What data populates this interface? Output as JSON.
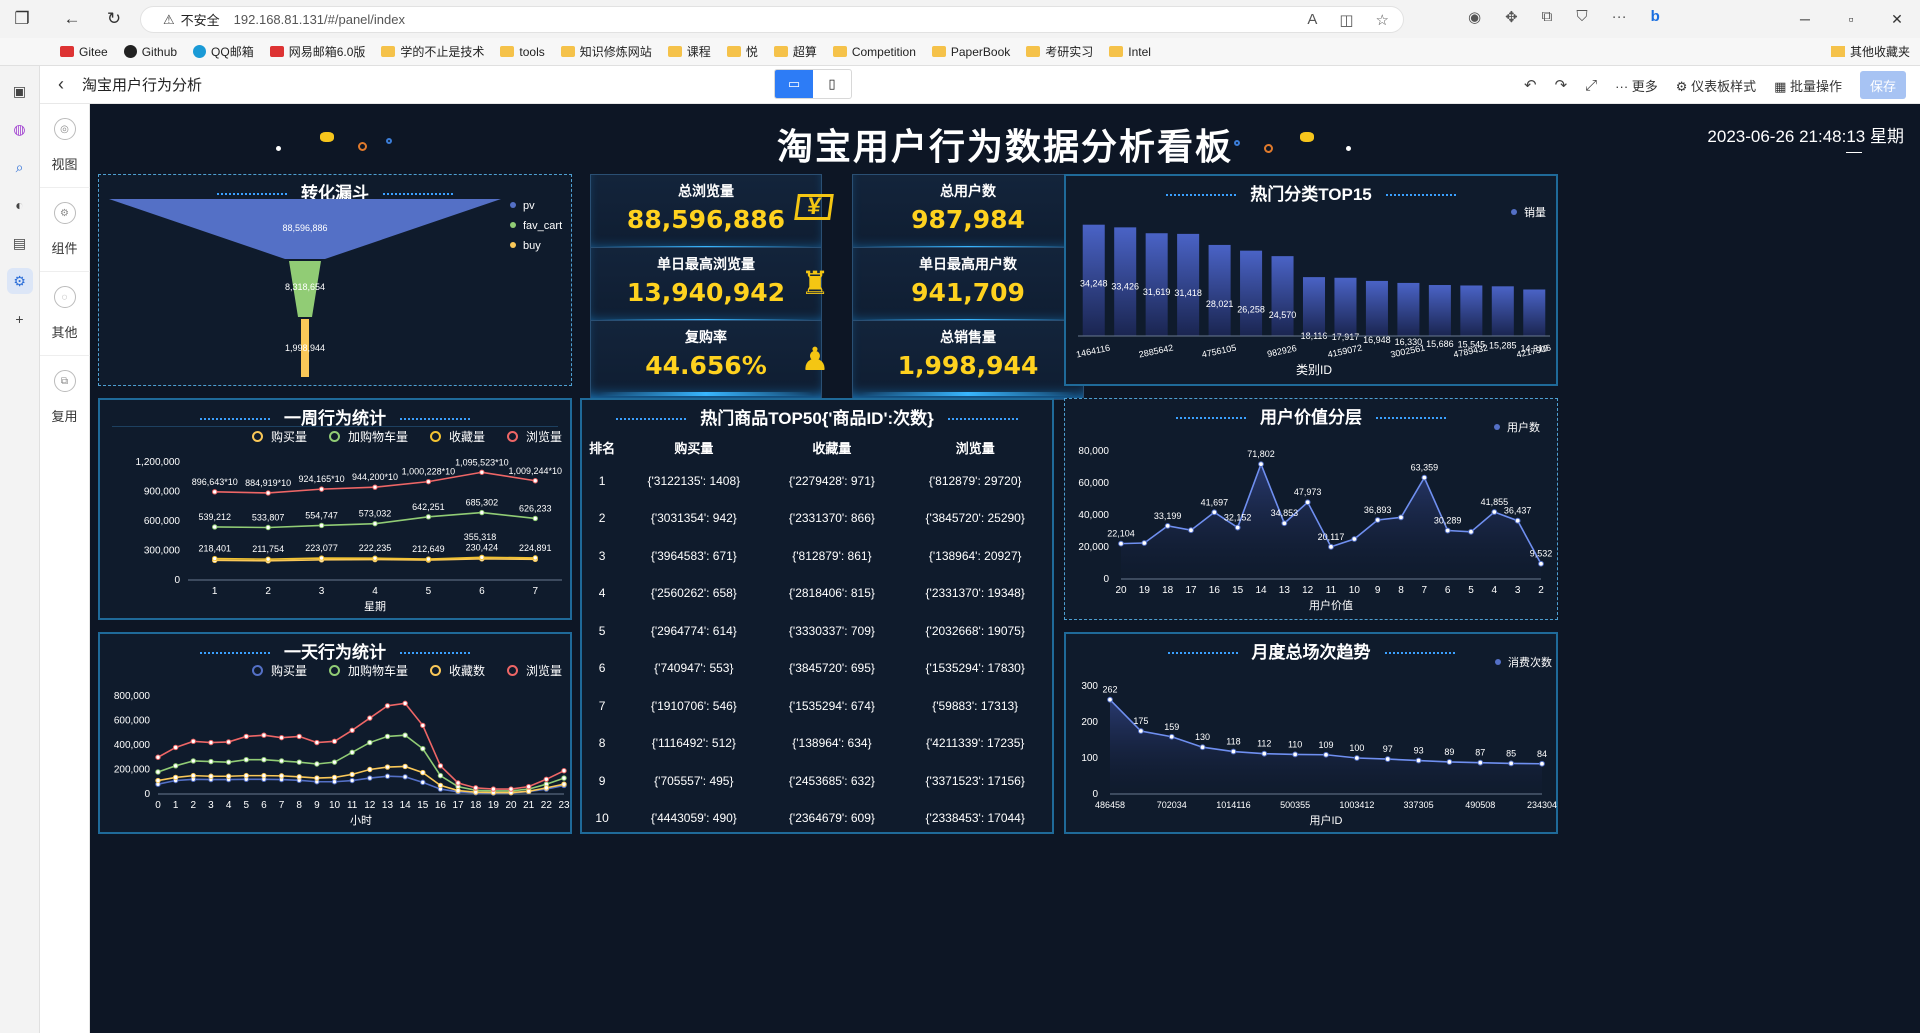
{
  "browser": {
    "security": "不安全",
    "url": "192.168.81.131/#/panel/index"
  },
  "bookmarks": [
    {
      "label": "Gitee",
      "kind": "red"
    },
    {
      "label": "Github",
      "kind": "dark"
    },
    {
      "label": "QQ邮箱",
      "kind": "qq"
    },
    {
      "label": "网易邮箱6.0版",
      "kind": "red"
    },
    {
      "label": "学的不止是技术",
      "kind": "folder"
    },
    {
      "label": "tools",
      "kind": "folder"
    },
    {
      "label": "知识修炼网站",
      "kind": "folder"
    },
    {
      "label": "课程",
      "kind": "folder"
    },
    {
      "label": "悦",
      "kind": "folder"
    },
    {
      "label": "超算",
      "kind": "folder"
    },
    {
      "label": "Competition",
      "kind": "folder"
    },
    {
      "label": "PaperBook",
      "kind": "folder"
    },
    {
      "label": "考研实习",
      "kind": "folder"
    },
    {
      "label": "Intel",
      "kind": "folder"
    }
  ],
  "bookmarks_other": "其他收藏夹",
  "app": {
    "title": "淘宝用户行为分析",
    "more": "更多",
    "style": "仪表板样式",
    "batch": "批量操作",
    "save": "保存"
  },
  "leftpanel": [
    {
      "label": "视图"
    },
    {
      "label": "组件"
    },
    {
      "label": "其他"
    },
    {
      "label": "复用"
    }
  ],
  "dashboard": {
    "title": "淘宝用户行为数据分析看板",
    "time": "2023-06-26 21:48:13 星期"
  },
  "kpis": [
    {
      "label": "总浏览量",
      "value": "88,596,886"
    },
    {
      "label": "总用户数",
      "value": "987,984"
    },
    {
      "label": "单日最高浏览量",
      "value": "13,940,942"
    },
    {
      "label": "单日最高用户数",
      "value": "941,709"
    },
    {
      "label": "复购率",
      "value": "44.656%"
    },
    {
      "label": "总销售量",
      "value": "1,998,944"
    }
  ],
  "funnel": {
    "title": "转化漏斗",
    "legend": [
      "pv",
      "fav_cart",
      "buy"
    ],
    "labels": [
      "88,596,886",
      "8,318,654",
      "1,998,944"
    ]
  },
  "chart_data": [
    {
      "id": "funnel",
      "type": "funnel",
      "title": "转化漏斗",
      "categories": [
        "pv",
        "fav_cart",
        "buy"
      ],
      "values": [
        88596886,
        8318654,
        1998944
      ],
      "colors": [
        "#5470c6",
        "#91cc75",
        "#fac858"
      ]
    },
    {
      "id": "top15",
      "type": "bar",
      "title": "热门分类TOP15",
      "xlabel": "类别ID",
      "series": [
        {
          "name": "销量",
          "values": [
            34248,
            33426,
            31619,
            31418,
            28021,
            26258,
            24570,
            18116,
            17917,
            16948,
            16330,
            15686,
            15545,
            15285,
            14310
          ]
        }
      ],
      "tick_labels": [
        "1464116",
        "2885642",
        "4756105",
        "982926",
        "4159072",
        "3002561",
        "4789432",
        "4217906"
      ],
      "ylim": [
        0,
        40000
      ]
    },
    {
      "id": "week",
      "type": "line",
      "title": "一周行为统计",
      "xlabel": "星期",
      "categories": [
        "1",
        "2",
        "3",
        "4",
        "5",
        "6",
        "7"
      ],
      "yticks": [
        "0",
        "300,000",
        "600,000",
        "900,000",
        "1,200,000"
      ],
      "ylim": [
        0,
        1200000
      ],
      "series": [
        {
          "name": "购买量",
          "color": "#fac858",
          "values": [
            200000,
            195000,
            205000,
            208000,
            203000,
            215000,
            210000
          ]
        },
        {
          "name": "加购物车量",
          "color": "#91cc75",
          "values": [
            539212,
            533807,
            554747,
            573032,
            642251,
            685302,
            626233
          ],
          "labels": [
            "539,212",
            "533,807",
            "554,747",
            "573,032",
            "642,251",
            "685,302",
            "626,233"
          ]
        },
        {
          "name": "收藏量",
          "color": "#f1c232",
          "values": [
            218401,
            211754,
            223077,
            222235,
            212649,
            230424,
            224891
          ],
          "labels": [
            "218,401",
            "211,754",
            "223,077",
            "222,235",
            "212,649",
            "230,424",
            "224,891"
          ]
        },
        {
          "name": "浏览量",
          "color": "#ee6666",
          "values": [
            896643,
            884919,
            924165,
            944200,
            1000228,
            1095523,
            1009244
          ],
          "labels": [
            "896,643*10",
            "884,919*10",
            "924,165*10",
            "944,200*10",
            "1,000,228*10",
            "1,095,523*10",
            "1,009,244*10"
          ]
        }
      ],
      "extra_label": "355,318"
    },
    {
      "id": "day",
      "type": "line",
      "title": "一天行为统计",
      "xlabel": "小时",
      "categories": [
        "0",
        "1",
        "2",
        "3",
        "4",
        "5",
        "6",
        "7",
        "8",
        "9",
        "10",
        "11",
        "12",
        "13",
        "14",
        "15",
        "16",
        "17",
        "18",
        "19",
        "20",
        "21",
        "22",
        "23"
      ],
      "yticks": [
        "0",
        "200,000",
        "400,000",
        "600,000",
        "800,000"
      ],
      "ylim": [
        0,
        800000
      ],
      "series": [
        {
          "name": "购买量",
          "color": "#5470c6",
          "values": [
            80000,
            110000,
            120000,
            118000,
            118000,
            120000,
            120000,
            118000,
            112000,
            100000,
            100000,
            110000,
            130000,
            145000,
            140000,
            95000,
            40000,
            18000,
            10000,
            8000,
            10000,
            20000,
            40000,
            70000
          ]
        },
        {
          "name": "加购物车量",
          "color": "#91cc75",
          "values": [
            180000,
            230000,
            270000,
            265000,
            260000,
            280000,
            280000,
            270000,
            260000,
            245000,
            260000,
            340000,
            420000,
            470000,
            480000,
            370000,
            150000,
            60000,
            30000,
            25000,
            25000,
            40000,
            80000,
            130000
          ]
        },
        {
          "name": "收藏数",
          "color": "#fac858",
          "values": [
            110000,
            135000,
            150000,
            145000,
            145000,
            150000,
            150000,
            148000,
            140000,
            130000,
            135000,
            160000,
            200000,
            220000,
            225000,
            175000,
            70000,
            28000,
            15000,
            12000,
            12000,
            22000,
            50000,
            80000
          ]
        },
        {
          "name": "浏览量",
          "color": "#ee6666",
          "values": [
            300000,
            380000,
            430000,
            420000,
            425000,
            470000,
            480000,
            460000,
            470000,
            420000,
            430000,
            520000,
            620000,
            720000,
            740000,
            560000,
            230000,
            90000,
            50000,
            40000,
            40000,
            60000,
            120000,
            190000
          ]
        }
      ]
    },
    {
      "id": "uservalue",
      "type": "area",
      "title": "用户价值分层",
      "xlabel": "用户价值",
      "series": [
        {
          "name": "用户数",
          "values": [
            22104,
            22500,
            33199,
            30500,
            41697,
            32152,
            71802,
            34853,
            47973,
            20117,
            25000,
            36893,
            38500,
            63359,
            30289,
            29500,
            41855,
            36437,
            9532
          ]
        }
      ],
      "categories": [
        "20",
        "19",
        "18",
        "17",
        "16",
        "15",
        "14",
        "13",
        "12",
        "11",
        "10",
        "9",
        "8",
        "7",
        "6",
        "5",
        "4",
        "3",
        "2"
      ],
      "point_labels": [
        "22,104",
        "",
        "33,199",
        "",
        "41,697",
        "32,152",
        "71,802",
        "34,853",
        "47,973",
        "20,117",
        "",
        "36,893",
        "",
        "63,359",
        "30,289",
        "",
        "41,855",
        "36,437",
        "9,532"
      ],
      "yticks": [
        "0",
        "20,000",
        "40,000",
        "60,000",
        "80,000"
      ],
      "ylim": [
        0,
        80000
      ]
    },
    {
      "id": "monthly",
      "type": "area",
      "title": "月度总场次趋势",
      "xlabel": "用户ID",
      "series": [
        {
          "name": "消费次数",
          "values": [
            262,
            175,
            159,
            130,
            118,
            112,
            110,
            109,
            100,
            97,
            93,
            89,
            87,
            85,
            84
          ]
        }
      ],
      "tick_labels": [
        "486458",
        "702034",
        "1014116",
        "500355",
        "1003412",
        "337305",
        "490508",
        "234304"
      ],
      "yticks": [
        "0",
        "100",
        "200",
        "300"
      ],
      "ylim": [
        0,
        300
      ]
    }
  ],
  "top50": {
    "title": "热门商品TOP50{'商品ID':次数}",
    "headers": [
      "排名",
      "购买量",
      "收藏量",
      "浏览量"
    ],
    "rows": [
      [
        "1",
        "{'3122135': 1408}",
        "{'2279428': 971}",
        "{'812879': 29720}"
      ],
      [
        "2",
        "{'3031354': 942}",
        "{'2331370': 866}",
        "{'3845720': 25290}"
      ],
      [
        "3",
        "{'3964583': 671}",
        "{'812879': 861}",
        "{'138964': 20927}"
      ],
      [
        "4",
        "{'2560262': 658}",
        "{'2818406': 815}",
        "{'2331370': 19348}"
      ],
      [
        "5",
        "{'2964774': 614}",
        "{'3330337': 709}",
        "{'2032668': 19075}"
      ],
      [
        "6",
        "{'740947': 553}",
        "{'3845720': 695}",
        "{'1535294': 17830}"
      ],
      [
        "7",
        "{'1910706': 546}",
        "{'1535294': 674}",
        "{'59883': 17313}"
      ],
      [
        "8",
        "{'1116492': 512}",
        "{'138964': 634}",
        "{'4211339': 17235}"
      ],
      [
        "9",
        "{'705557': 495}",
        "{'2453685': 632}",
        "{'3371523': 17156}"
      ],
      [
        "10",
        "{'4443059': 490}",
        "{'2364679': 609}",
        "{'2338453': 17044}"
      ]
    ]
  }
}
